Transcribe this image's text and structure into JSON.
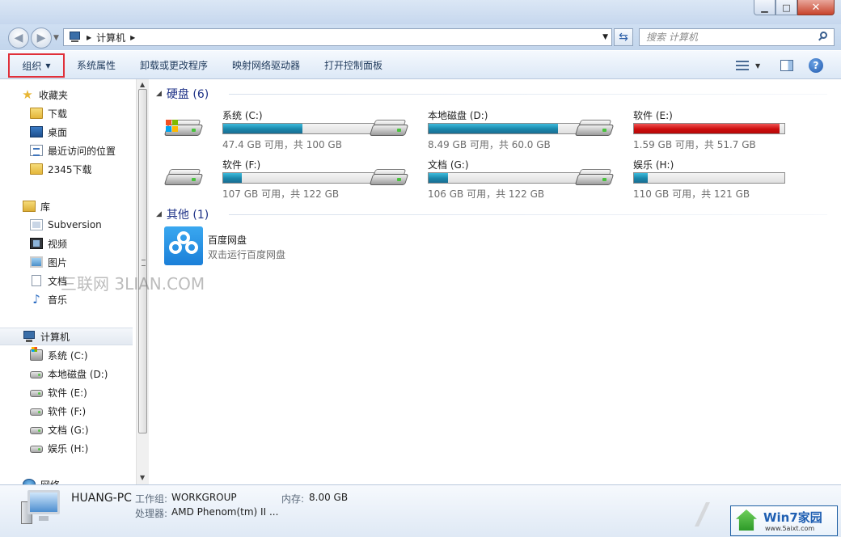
{
  "window": {
    "minimize_glyph": "▁",
    "maximize_glyph": "□",
    "close_glyph": "✕"
  },
  "address": {
    "path": "计算机",
    "icon": "computer-icon",
    "search_placeholder": "搜索 计算机"
  },
  "toolbar": {
    "organize": "组织",
    "system_properties": "系统属性",
    "uninstall": "卸载或更改程序",
    "map_drive": "映射网络驱动器",
    "control_panel": "打开控制面板",
    "help": "?"
  },
  "sidebar": {
    "favorites": {
      "header": "收藏夹",
      "items": [
        "下载",
        "桌面",
        "最近访问的位置",
        "2345下载"
      ]
    },
    "libraries": {
      "header": "库",
      "items": [
        "Subversion",
        "视频",
        "图片",
        "文档",
        "音乐"
      ]
    },
    "computer": {
      "header": "计算机",
      "items": [
        "系统 (C:)",
        "本地磁盘 (D:)",
        "软件 (E:)",
        "软件 (F:)",
        "文档 (G:)",
        "娱乐 (H:)"
      ]
    },
    "network": {
      "header": "网络"
    }
  },
  "main": {
    "hard_disks_header": "硬盘 (6)",
    "other_header": "其他 (1)",
    "drives": [
      {
        "label": "系统 (C:)",
        "info": "47.4 GB 可用，共 100 GB",
        "used_fraction": 0.526,
        "status": "normal",
        "system": true
      },
      {
        "label": "本地磁盘 (D:)",
        "info": "8.49 GB 可用，共 60.0 GB",
        "used_fraction": 0.858,
        "status": "normal",
        "system": false
      },
      {
        "label": "软件 (E:)",
        "info": "1.59 GB 可用，共 51.7 GB",
        "used_fraction": 0.969,
        "status": "full",
        "system": false
      },
      {
        "label": "软件 (F:)",
        "info": "107 GB 可用，共 122 GB",
        "used_fraction": 0.123,
        "status": "normal",
        "system": false
      },
      {
        "label": "文档 (G:)",
        "info": "106 GB 可用，共 122 GB",
        "used_fraction": 0.131,
        "status": "normal",
        "system": false
      },
      {
        "label": "娱乐 (H:)",
        "info": "110 GB 可用，共 121 GB",
        "used_fraction": 0.091,
        "status": "normal",
        "system": false
      }
    ],
    "other": {
      "name": "百度网盘",
      "desc": "双击运行百度网盘"
    }
  },
  "details": {
    "pc_name": "HUANG-PC",
    "workgroup_label": "工作组:",
    "workgroup_value": "WORKGROUP",
    "memory_label": "内存:",
    "memory_value": "8.00 GB",
    "processor_label": "处理器:",
    "processor_value": "AMD Phenom(tm) II ..."
  },
  "watermark": "三联网 3LIAN.COM",
  "badge": {
    "title": "Win7家园",
    "url": "www.5aixt.com"
  },
  "colors": {
    "bar_normal": "#1986aa",
    "bar_full": "#cc0d0d",
    "group_header": "#1e3287",
    "organize_highlight": "#e0303a"
  }
}
